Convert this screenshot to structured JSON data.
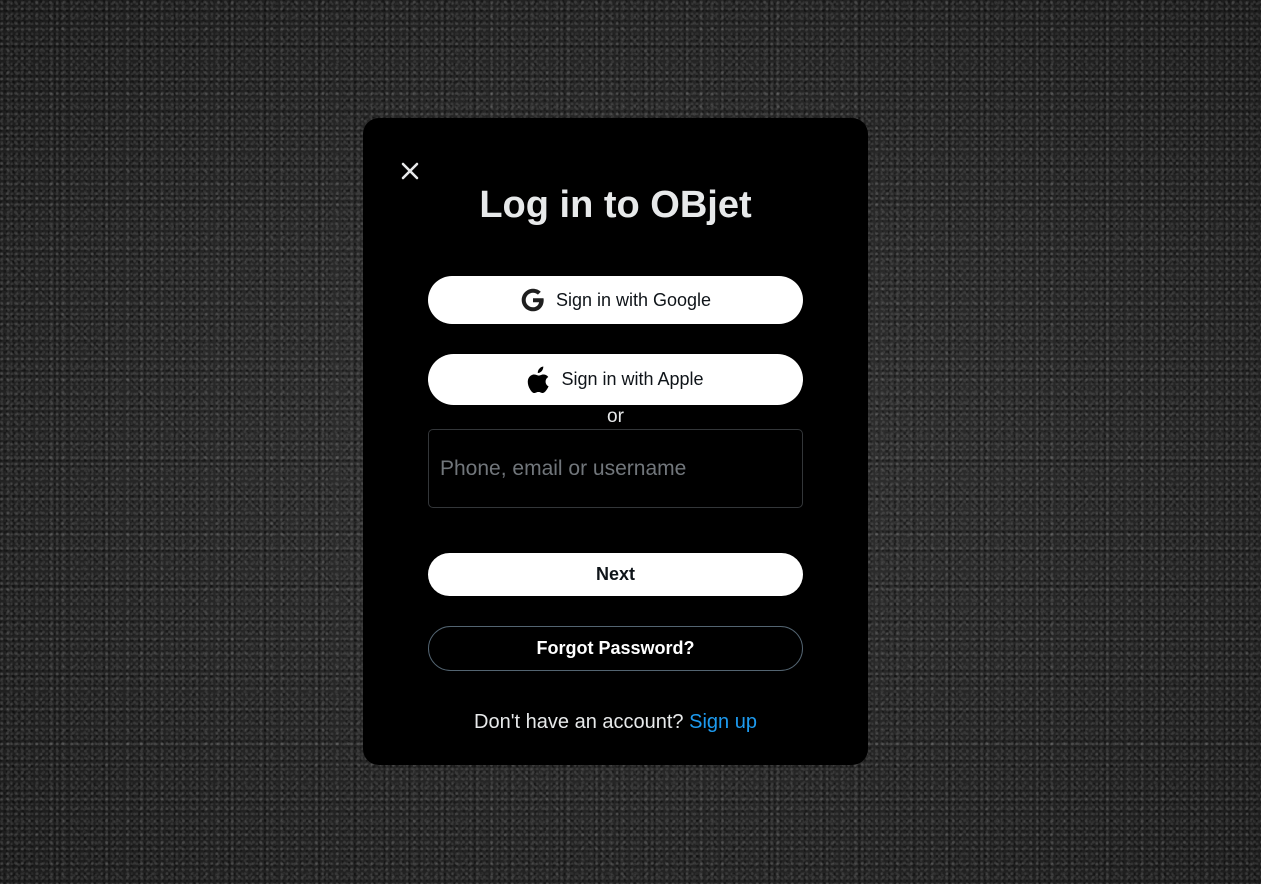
{
  "modal": {
    "close_icon": "close-icon",
    "title": "Log in to OBjet",
    "google_button": {
      "label": "Sign in with Google",
      "icon": "google-icon"
    },
    "apple_button": {
      "label": "Sign in with Apple",
      "icon": "apple-icon"
    },
    "divider_text": "or",
    "identifier_input": {
      "placeholder": "Phone, email or username",
      "value": ""
    },
    "next_button": {
      "label": "Next"
    },
    "forgot_password_button": {
      "label": "Forgot Password?"
    },
    "signup_prompt": {
      "text": "Don't have an account?",
      "link_label": "Sign up"
    }
  },
  "colors": {
    "modal_background": "#000000",
    "link_accent": "#1d9bf0",
    "button_light": "#ffffff",
    "button_outline": "#536471"
  }
}
